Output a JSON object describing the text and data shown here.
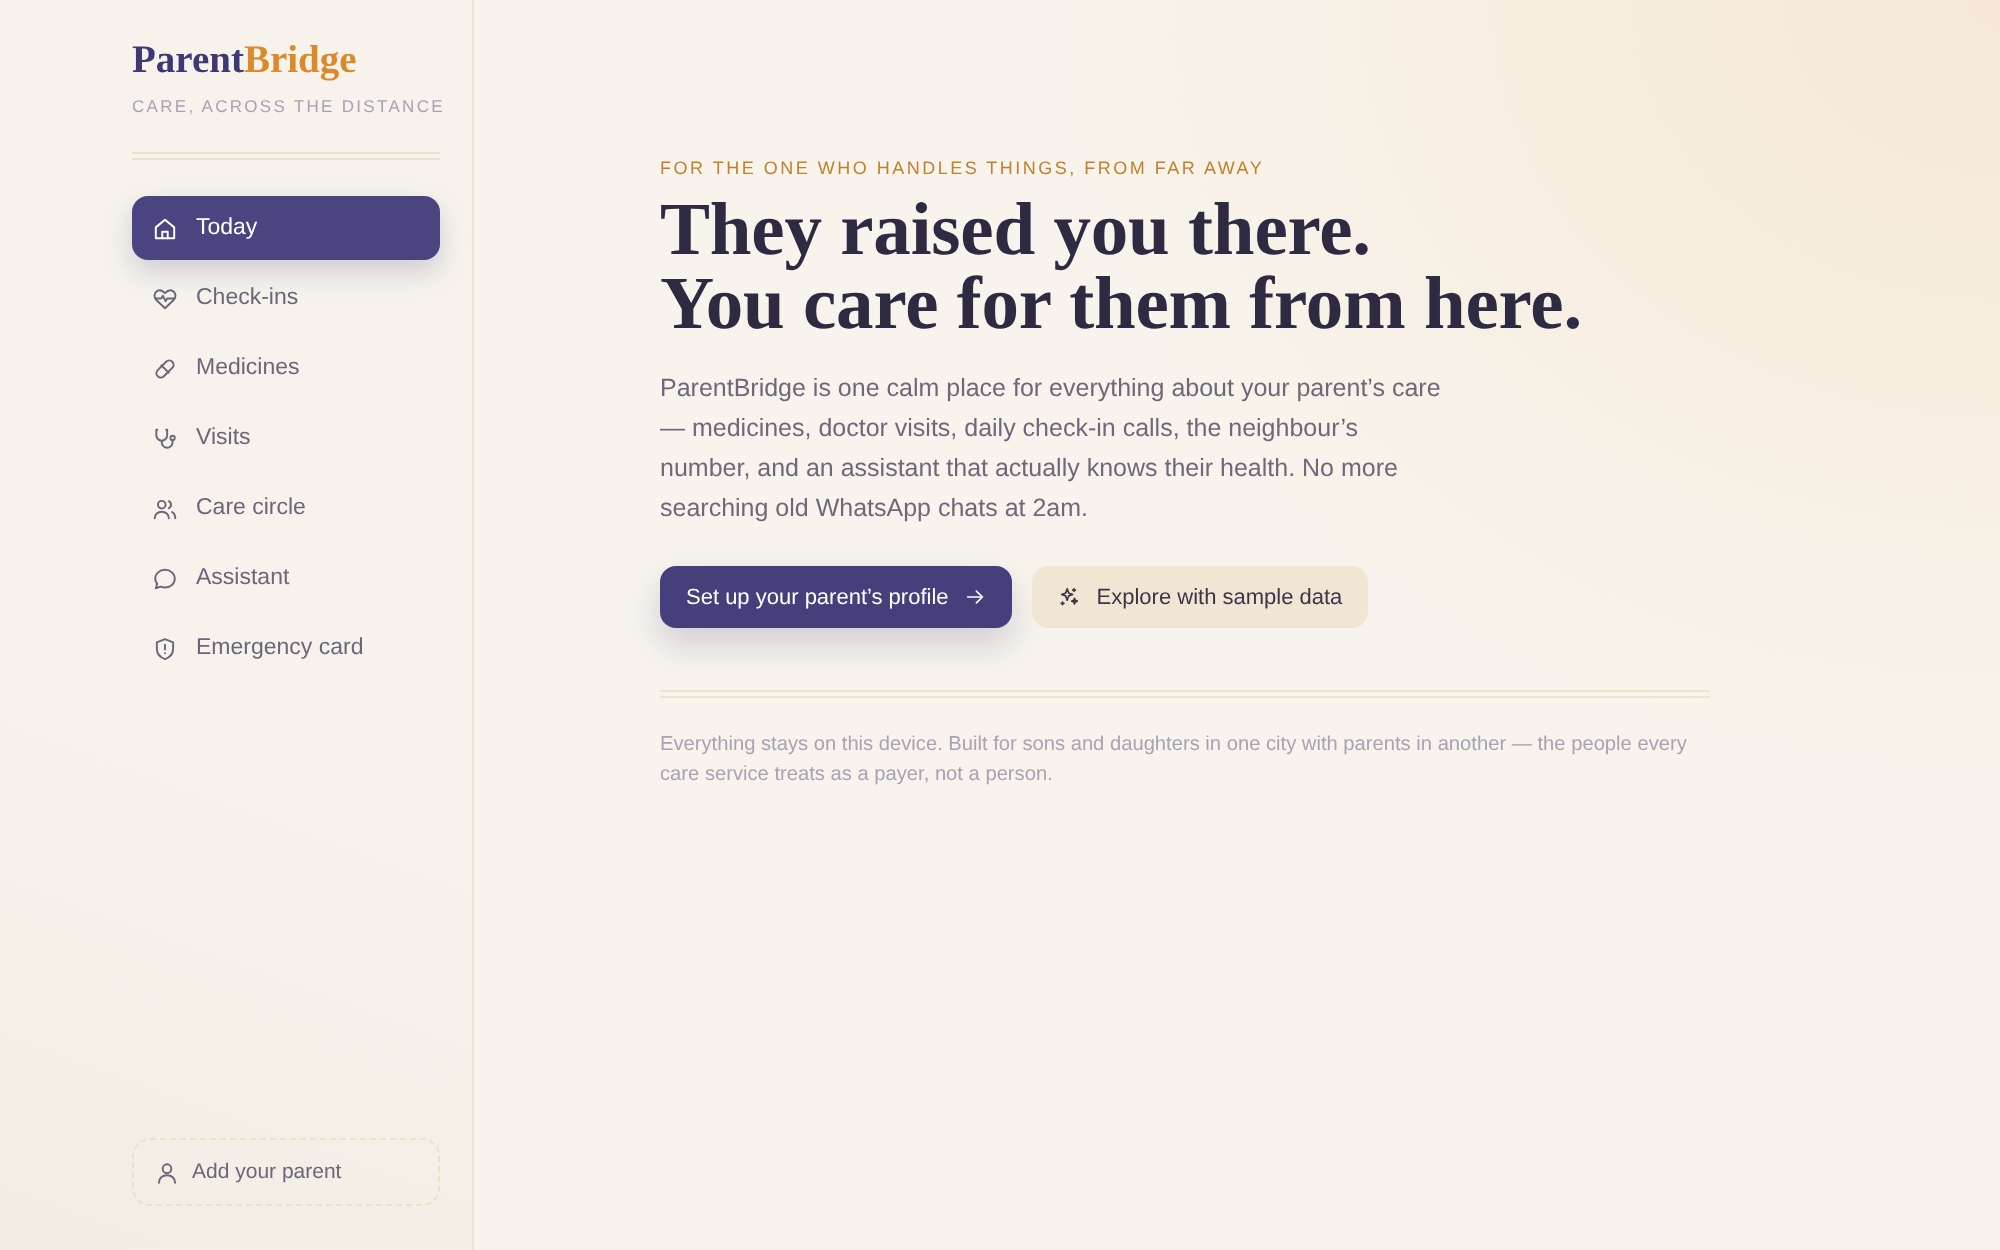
{
  "brand": {
    "name_part_1": "Parent",
    "name_part_2": "Bridge",
    "tagline": "CARE, ACROSS THE DISTANCE"
  },
  "sidebar": {
    "items": [
      {
        "label": "Today",
        "selected": true
      },
      {
        "label": "Check-ins",
        "selected": false
      },
      {
        "label": "Medicines",
        "selected": false
      },
      {
        "label": "Visits",
        "selected": false
      },
      {
        "label": "Care circle",
        "selected": false
      },
      {
        "label": "Assistant",
        "selected": false
      },
      {
        "label": "Emergency card",
        "selected": false
      }
    ],
    "add_button": {
      "label": "Add your parent"
    }
  },
  "hero": {
    "eyebrow": "FOR THE ONE WHO HANDLES THINGS, FROM FAR AWAY",
    "heading_lines": [
      "They raised you there.",
      "You care for them from here."
    ],
    "description": "ParentBridge is one calm place for everything about your parent’s care — medicines, doctor visits, daily check-in calls, the neighbour’s number, and an assistant that actually knows their health. No more searching old WhatsApp chats at 2am.",
    "buttons": [
      {
        "kind": "primary",
        "label": "Set up your parent’s profile"
      },
      {
        "kind": "secondary",
        "label": "Explore with sample data"
      }
    ],
    "footnote": "Everything stays on this device. Built for sons and daughters in one city with parents in another — the people every care service treats as a payer, not a person."
  }
}
